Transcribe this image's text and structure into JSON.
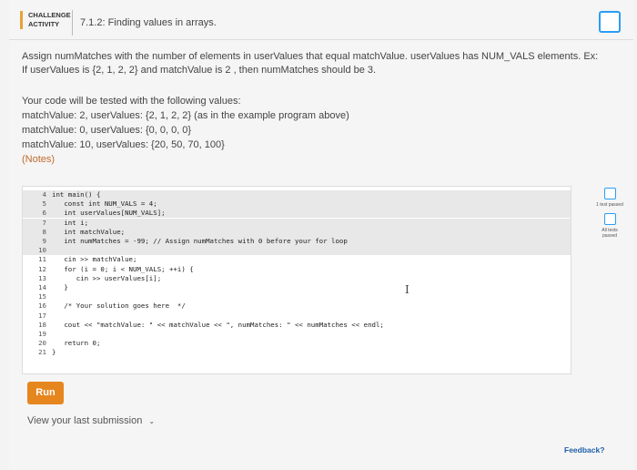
{
  "header": {
    "badge_line1": "CHALLENGE",
    "badge_line2": "ACTIVITY",
    "title": "7.1.2: Finding values in arrays."
  },
  "prompt": {
    "line1": "Assign numMatches with the number of elements in userValues that equal matchValue. userValues has NUM_VALS elements. Ex:",
    "line2": "If userValues is {2, 1, 2, 2} and matchValue is 2 , then numMatches should be 3."
  },
  "tests": {
    "intro": "Your code will be tested with the following values:",
    "cases": [
      "matchValue: 2, userValues: {2, 1, 2, 2} (as in the example program above)",
      "matchValue: 0, userValues: {0, 0, 0, 0}",
      "matchValue: 10, userValues: {20, 50, 70, 100}"
    ],
    "notes": "(Notes)"
  },
  "editor": {
    "lines": [
      {
        "n": "4",
        "text": "int main() {",
        "readonly": true
      },
      {
        "n": "5",
        "text": "   const int NUM_VALS = 4;",
        "readonly": true
      },
      {
        "n": "6",
        "text": "   int userValues[NUM_VALS];",
        "readonly": true
      },
      {
        "n": "7",
        "text": "   int i;",
        "readonly": true
      },
      {
        "n": "8",
        "text": "   int matchValue;",
        "readonly": true
      },
      {
        "n": "9",
        "text": "   int numMatches = -99; // Assign numMatches with 0 before your for loop",
        "readonly": true
      },
      {
        "n": "10",
        "text": "",
        "readonly": true
      },
      {
        "n": "11",
        "text": "   cin >> matchValue;",
        "readonly": false
      },
      {
        "n": "12",
        "text": "   for (i = 0; i < NUM_VALS; ++i) {",
        "readonly": false
      },
      {
        "n": "13",
        "text": "      cin >> userValues[i];",
        "readonly": false
      },
      {
        "n": "14",
        "text": "   }",
        "readonly": false
      },
      {
        "n": "15",
        "text": "",
        "readonly": false
      },
      {
        "n": "16",
        "text": "   /* Your solution goes here  */",
        "readonly": false
      },
      {
        "n": "17",
        "text": "",
        "readonly": false
      },
      {
        "n": "18",
        "text": "   cout << \"matchValue: \" << matchValue << \", numMatches: \" << numMatches << endl;",
        "readonly": false
      },
      {
        "n": "19",
        "text": "",
        "readonly": false
      },
      {
        "n": "20",
        "text": "   return 0;",
        "readonly": false
      },
      {
        "n": "21",
        "text": "}",
        "readonly": false
      }
    ],
    "cursor_glyph": "I"
  },
  "side_status": {
    "first": "1 test passed",
    "second": "All tests passed"
  },
  "run_label": "Run",
  "last_submission": "View your last submission",
  "feedback": "Feedback?"
}
